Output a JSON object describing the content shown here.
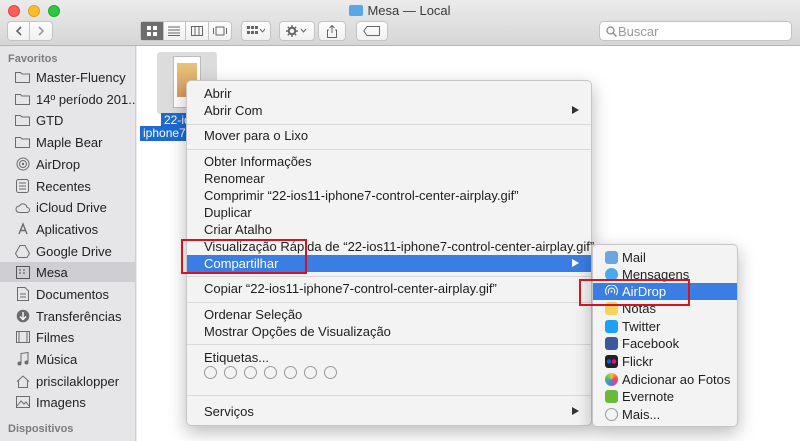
{
  "window": {
    "title": "Mesa — Local"
  },
  "toolbar": {
    "search_placeholder": "Buscar"
  },
  "sidebar": {
    "favorites_header": "Favoritos",
    "devices_header": "Dispositivos",
    "items": [
      {
        "label": "Master-Fluency",
        "icon": "folder-icon"
      },
      {
        "label": "14º período 201...",
        "icon": "folder-icon"
      },
      {
        "label": "GTD",
        "icon": "folder-icon"
      },
      {
        "label": "Maple Bear",
        "icon": "folder-icon"
      },
      {
        "label": "AirDrop",
        "icon": "airdrop-icon"
      },
      {
        "label": "Recentes",
        "icon": "recents-icon"
      },
      {
        "label": "iCloud Drive",
        "icon": "cloud-icon"
      },
      {
        "label": "Aplicativos",
        "icon": "applications-icon"
      },
      {
        "label": "Google Drive",
        "icon": "google-drive-icon"
      },
      {
        "label": "Mesa",
        "icon": "desktop-icon",
        "selected": true
      },
      {
        "label": "Documentos",
        "icon": "documents-icon"
      },
      {
        "label": "Transferências",
        "icon": "downloads-icon"
      },
      {
        "label": "Filmes",
        "icon": "movies-icon"
      },
      {
        "label": "Música",
        "icon": "music-icon"
      },
      {
        "label": "priscilaklopper",
        "icon": "home-icon"
      },
      {
        "label": "Imagens",
        "icon": "pictures-icon"
      }
    ]
  },
  "file": {
    "name_line1": "22-ios",
    "name_line2": "iphone7..."
  },
  "context_menu": {
    "items": [
      {
        "label": "Abrir"
      },
      {
        "label": "Abrir Com",
        "submenu": true
      },
      {
        "label": "Mover para o Lixo"
      },
      {
        "label": "Obter Informações"
      },
      {
        "label": "Renomear"
      },
      {
        "label": "Comprimir “22-ios11-iphone7-control-center-airplay.gif”"
      },
      {
        "label": "Duplicar"
      },
      {
        "label": "Criar Atalho"
      },
      {
        "label": "Visualização Rápida de “22-ios11-iphone7-control-center-airplay.gif”"
      },
      {
        "label": "Compartilhar",
        "submenu": true,
        "highlighted": true
      },
      {
        "label": "Copiar “22-ios11-iphone7-control-center-airplay.gif”"
      },
      {
        "label": "Ordenar Seleção"
      },
      {
        "label": "Mostrar Opções de Visualização"
      },
      {
        "label": "Etiquetas..."
      },
      {
        "label": "Serviços",
        "submenu": true
      }
    ]
  },
  "share_menu": {
    "items": [
      {
        "label": "Mail",
        "icon": "mail-icon",
        "color": "#6ba6e0"
      },
      {
        "label": "Mensagens",
        "icon": "messages-icon",
        "color": "#4aa8f0"
      },
      {
        "label": "AirDrop",
        "icon": "airdrop-icon",
        "color": "#ffffff",
        "highlighted": true
      },
      {
        "label": "Notas",
        "icon": "notes-icon",
        "color": "#f3d45a"
      },
      {
        "label": "Twitter",
        "icon": "twitter-icon",
        "color": "#1da1f2"
      },
      {
        "label": "Facebook",
        "icon": "facebook-icon",
        "color": "#3b5998"
      },
      {
        "label": "Flickr",
        "icon": "flickr-icon",
        "color": "#222222"
      },
      {
        "label": "Adicionar ao Fotos",
        "icon": "photos-icon",
        "color": "#e8a33c"
      },
      {
        "label": "Evernote",
        "icon": "evernote-icon",
        "color": "#6cb83a"
      },
      {
        "label": "Mais...",
        "icon": "more-icon",
        "color": "#dddddd"
      }
    ]
  }
}
